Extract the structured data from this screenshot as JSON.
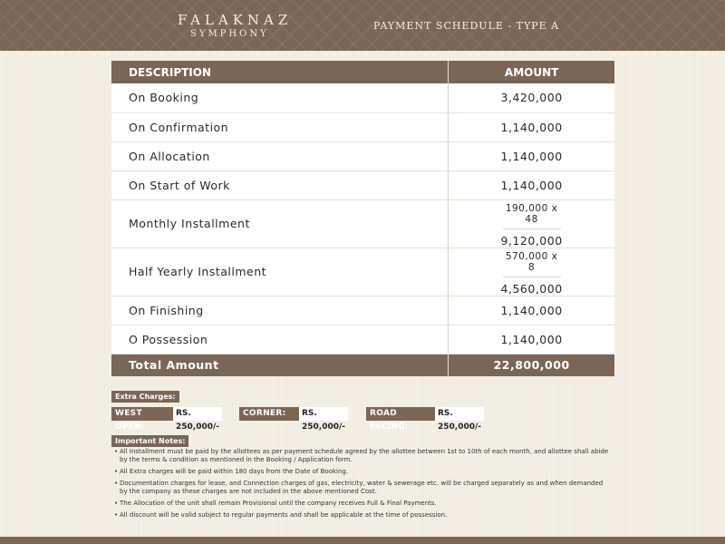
{
  "header": {
    "brand_name": "FALAKNAZ",
    "brand_sub": "SYMPHONY",
    "title": "PAYMENT SCHEDULE - TYPE A"
  },
  "table": {
    "columns": [
      "DESCRIPTION",
      "AMOUNT"
    ],
    "rows": [
      {
        "description": "On Booking",
        "amount": "3,420,000"
      },
      {
        "description": "On Confirmation",
        "amount": "1,140,000"
      },
      {
        "description": "On Allocation",
        "amount": "1,140,000"
      },
      {
        "description": "On Start of Work",
        "amount": "1,140,000"
      },
      {
        "description": "Monthly Installment",
        "detail": "190,000 x 48",
        "amount": "9,120,000"
      },
      {
        "description": "Half Yearly Installment",
        "detail": "570,000 x 8",
        "amount": "4,560,000"
      },
      {
        "description": "On Finishing",
        "amount": "1,140,000"
      },
      {
        "description": "O Possession",
        "amount": "1,140,000"
      }
    ],
    "total": {
      "label": "Total Amount",
      "amount": "22,800,000"
    }
  },
  "extra_charges": {
    "label": "Extra Charges:",
    "items": [
      {
        "label": "WEST OPEN:",
        "value": "RS. 250,000/-"
      },
      {
        "label": "CORNER:",
        "value": "RS. 250,000/-"
      },
      {
        "label": "ROAD FACING:",
        "value": "RS. 250,000/-"
      }
    ]
  },
  "notes": {
    "label": "Important Notes:",
    "items": [
      "All Installment must be paid by the allottees as per payment schedule agreed by the allottee between 1st to 10th of each month, and allottee shall abide by the terms & condition as mentioned in the Booking / Application form.",
      "All Extra charges will be paid within 180 days from the Date of Booking.",
      "Documentation charges for lease, and Connection charges of gas, electricity, water & sewerage etc. will be charged separately as and when demanded by the company as these charges are not included in the above mentioned Cost.",
      "The Allocation of the unit shall remain Provisional until the company receives Full & Final Payments.",
      "All discount will be valid subject to regular payments and shall be applicable at the time of possession."
    ]
  }
}
